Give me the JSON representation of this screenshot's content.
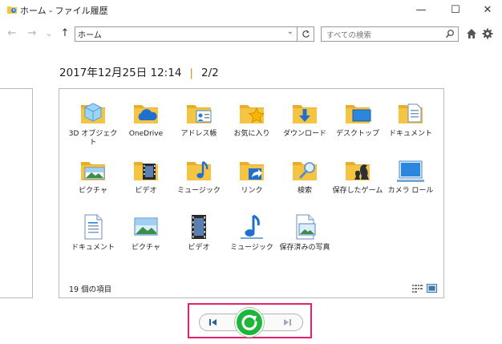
{
  "window": {
    "title": "ホーム - ファイル履歴",
    "minimize_glyph": "—",
    "maximize_glyph": "☐",
    "close_glyph": "✕"
  },
  "navigation": {
    "back_glyph": "←",
    "forward_glyph": "→",
    "dropdown_glyph": "⌄",
    "up_glyph": "↑",
    "address": "ホーム",
    "search_placeholder": "すべての検索"
  },
  "header": {
    "date": "2017年12月25日 12:14",
    "separator": "|",
    "version": "2/2"
  },
  "items": [
    {
      "label": "3D オブジェクト",
      "icon": "folder-3d-objects-icon"
    },
    {
      "label": "OneDrive",
      "icon": "folder-onedrive-icon"
    },
    {
      "label": "アドレス帳",
      "icon": "folder-contacts-icon"
    },
    {
      "label": "お気に入り",
      "icon": "folder-favorites-icon"
    },
    {
      "label": "ダウンロード",
      "icon": "folder-downloads-icon"
    },
    {
      "label": "デスクトップ",
      "icon": "folder-desktop-icon"
    },
    {
      "label": "ドキュメント",
      "icon": "folder-documents-icon"
    },
    {
      "label": "ピクチャ",
      "icon": "folder-pictures-icon"
    },
    {
      "label": "ビデオ",
      "icon": "folder-videos-icon"
    },
    {
      "label": "ミュージック",
      "icon": "folder-music-icon"
    },
    {
      "label": "リンク",
      "icon": "folder-links-icon"
    },
    {
      "label": "検索",
      "icon": "folder-searches-icon"
    },
    {
      "label": "保存したゲーム",
      "icon": "folder-saved-games-icon"
    },
    {
      "label": "カメラ ロール",
      "icon": "library-camera-roll-icon"
    },
    {
      "label": "ドキュメント",
      "icon": "library-documents-icon"
    },
    {
      "label": "ピクチャ",
      "icon": "library-pictures-icon"
    },
    {
      "label": "ビデオ",
      "icon": "library-videos-icon"
    },
    {
      "label": "ミュージック",
      "icon": "library-music-icon"
    },
    {
      "label": "保存済みの写真",
      "icon": "library-saved-pictures-icon"
    }
  ],
  "status": {
    "item_count": "19 個の項目"
  },
  "colors": {
    "folder": "#f5c443",
    "accent_blue": "#2b7fd9",
    "highlight_frame": "#e2206f",
    "restore_green": "#1db63a"
  }
}
